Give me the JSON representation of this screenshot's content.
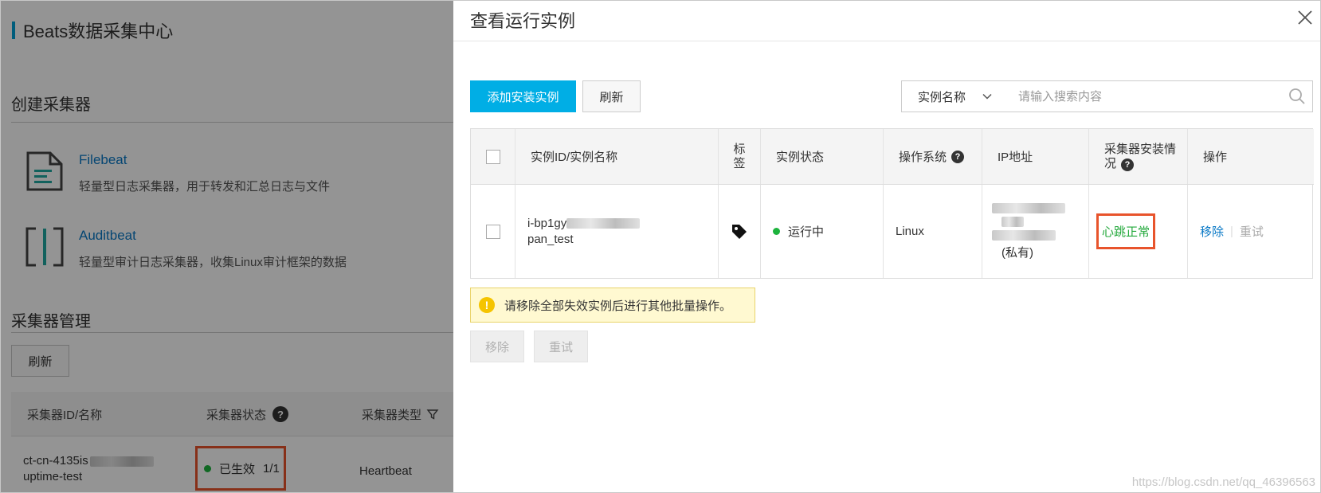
{
  "background_page": {
    "title": "Beats数据采集中心",
    "create_section_title": "创建采集器",
    "beats": [
      {
        "name": "Filebeat",
        "desc": "轻量型日志采集器，用于转发和汇总日志与文件",
        "icon": "file-lines-icon"
      },
      {
        "name": "Auditbeat",
        "desc": "轻量型审计日志采集器，收集Linux审计框架的数据",
        "icon": "audit-bracket-icon"
      }
    ],
    "manage_section_title": "采集器管理",
    "refresh_label": "刷新",
    "table": {
      "columns": [
        "采集器ID/名称",
        "采集器状态",
        "采集器类型"
      ],
      "row": {
        "id": "ct-cn-4135is",
        "name": "uptime-test",
        "status": "已生效",
        "status_count": "1/1",
        "type": "Heartbeat"
      }
    }
  },
  "drawer": {
    "title": "查看运行实例",
    "add_button": "添加安装实例",
    "refresh_button": "刷新",
    "search": {
      "select_value": "实例名称",
      "placeholder": "请输入搜索内容"
    },
    "table": {
      "columns": {
        "id_name": "实例ID/实例名称",
        "tag": "标签",
        "status": "实例状态",
        "os": "操作系统",
        "ip": "IP地址",
        "install": "采集器安装情况",
        "actions": "操作"
      },
      "row": {
        "instance_id": "i-bp1gy",
        "instance_name": "pan_test",
        "status": "运行中",
        "os": "Linux",
        "ip_suffix": "(私有)",
        "install_status": "心跳正常",
        "action_remove": "移除",
        "action_retry": "重试"
      }
    },
    "warning": "请移除全部失效实例后进行其他批量操作。",
    "bulk_remove": "移除",
    "bulk_retry": "重试"
  },
  "colors": {
    "accent": "#00aee5",
    "link": "#0a79c6",
    "highlight_border": "#e8542c",
    "ok_green": "#1db33d"
  },
  "watermark": "https://blog.csdn.net/qq_46396563"
}
